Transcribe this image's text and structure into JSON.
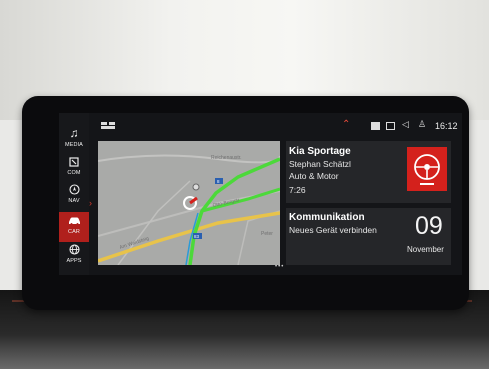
{
  "sidebar": {
    "items": [
      {
        "label": "MEDIA",
        "icon": "music-note-icon",
        "active": false
      },
      {
        "label": "COM",
        "icon": "phone-icon",
        "active": false
      },
      {
        "label": "NAV",
        "icon": "compass-icon",
        "active": false
      },
      {
        "label": "CAR",
        "icon": "car-icon",
        "active": true
      },
      {
        "label": "APPS",
        "icon": "globe-icon",
        "active": false
      }
    ]
  },
  "status_bar": {
    "time": "16:12",
    "icons": [
      "layout-icon",
      "chevron-up-icon",
      "display-icon",
      "screen-icon",
      "volume-icon",
      "user-icon"
    ]
  },
  "map": {
    "streets": [
      "Reichenaustr.",
      "Otto-Burgstr.",
      "Am Waldsteig",
      "Peter"
    ],
    "route_shields": [
      "8",
      "83"
    ]
  },
  "media_card": {
    "title": "Kia Sportage",
    "line1": "Stephan Schätzl",
    "line2": "Auto & Motor",
    "elapsed": "7:26",
    "badge_icon": "steering-wheel-icon"
  },
  "communication_card": {
    "title": "Kommunikation",
    "subtitle": "Neues Gerät verbinden",
    "day": "09",
    "month": "November"
  },
  "page_indicator": "•••",
  "colors": {
    "accent": "#d4211c",
    "screen_bg": "#141518",
    "card_bg": "#252629",
    "map_bg": "#a9aaa8",
    "route_green": "#4cd93a",
    "road_yellow": "#e8c34a"
  }
}
